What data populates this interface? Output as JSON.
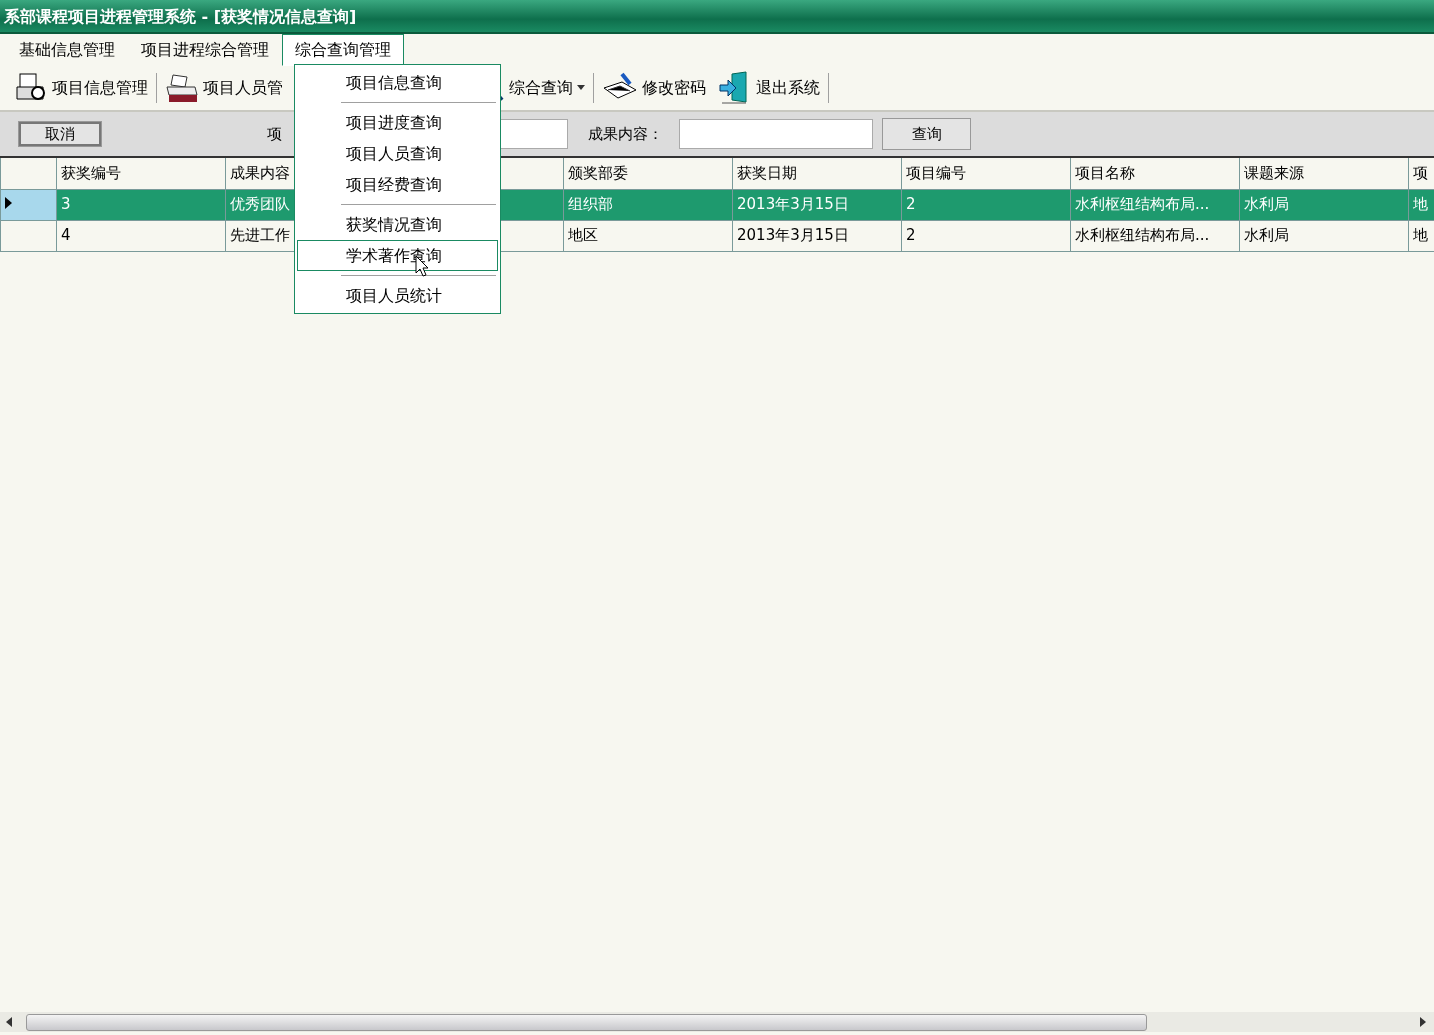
{
  "window": {
    "title": "系部课程项目进程管理系统 - [获奖情况信息查询]"
  },
  "menus": [
    {
      "label": "基础信息管理",
      "selected": false
    },
    {
      "label": "项目进程综合管理",
      "selected": false
    },
    {
      "label": "综合查询管理",
      "selected": true
    }
  ],
  "toolbar": [
    {
      "kind": "button",
      "label": "项目信息管理"
    },
    {
      "kind": "separator"
    },
    {
      "kind": "button",
      "label": "项目人员管"
    },
    {
      "kind": "dropdown",
      "label": "综合查询"
    },
    {
      "kind": "separator"
    },
    {
      "kind": "button",
      "label": "修改密码"
    },
    {
      "kind": "button",
      "label": "退出系统"
    },
    {
      "kind": "separator"
    }
  ],
  "filter": {
    "cancel_button": "取消",
    "label_1": "项",
    "label_2": "成果内容：",
    "search_button": "查询"
  },
  "table": {
    "columns": [
      "获奖编号",
      "成果内容",
      "颁奖部委",
      "获奖日期",
      "项目编号",
      "项目名称",
      "课题来源",
      "项"
    ],
    "rows": [
      {
        "selected": true,
        "cells": [
          "3",
          "优秀团队",
          "组织部",
          "2013年3月15日",
          "2",
          "水利枢纽结构布局...",
          "水利局",
          "地"
        ]
      },
      {
        "selected": false,
        "cells": [
          "4",
          "先进工作",
          "地区",
          "2013年3月15日",
          "2",
          "水利枢纽结构布局...",
          "水利局",
          "地"
        ]
      }
    ]
  },
  "dropdown": [
    {
      "kind": "item",
      "label": "项目信息查询",
      "selected": false
    },
    {
      "kind": "separator"
    },
    {
      "kind": "item",
      "label": "项目进度查询",
      "selected": false
    },
    {
      "kind": "item",
      "label": "项目人员查询",
      "selected": false
    },
    {
      "kind": "item",
      "label": "项目经费查询",
      "selected": false
    },
    {
      "kind": "separator"
    },
    {
      "kind": "item",
      "label": "获奖情况查询",
      "selected": false
    },
    {
      "kind": "item",
      "label": "学术著作查询",
      "selected": true
    },
    {
      "kind": "separator"
    },
    {
      "kind": "item",
      "label": "项目人员统计",
      "selected": false
    }
  ]
}
